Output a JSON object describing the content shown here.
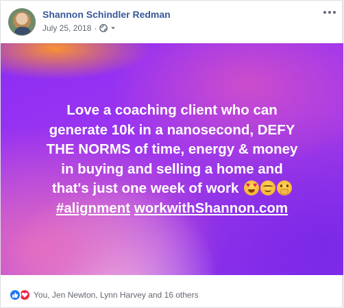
{
  "post": {
    "author": "Shannon Schindler Redman",
    "date": "July 25, 2018",
    "separator": "·",
    "audience_icon": "globe-icon",
    "menu_icon": "more-options-icon"
  },
  "card": {
    "background_colors": [
      "#8b2cf5",
      "#ff9628",
      "#e66ebe",
      "#7828e6"
    ],
    "lines": [
      "Love a coaching client who can",
      "generate 10k in a nanosecond, DEFY",
      "THE NORMS of time, energy & money",
      "in buying and selling a home and",
      "that's just one week of work"
    ],
    "emojis": [
      "heart-eyes-emoji",
      "relieved-face-emoji",
      "face-with-hand-over-mouth-emoji"
    ],
    "hashtag": "#alignment",
    "link": "workwithShannon.com"
  },
  "reactions": {
    "icons": [
      "like-icon",
      "love-icon"
    ],
    "summary": "You, Jen Newton, Lynn Harvey and 16 others"
  }
}
